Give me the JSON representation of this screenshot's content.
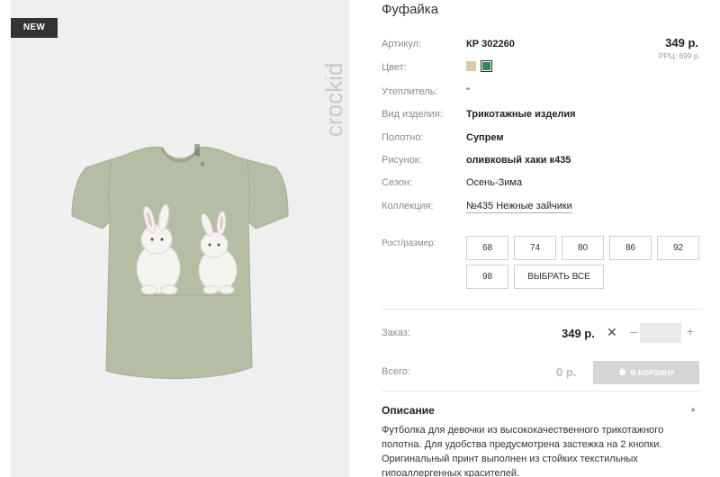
{
  "badge": "NEW",
  "brand": "crockid",
  "product": {
    "title": "Фуфайка",
    "price": "349 р.",
    "rrc": "РРЦ: 699 р."
  },
  "specs": {
    "article_label": "Артикул:",
    "article_value": "КР 302260",
    "color_label": "Цвет:",
    "insulation_label": "Утеплитель:",
    "insulation_value": "\"",
    "type_label": "Вид изделия:",
    "type_value": "Трикотажные изделия",
    "fabric_label": "Полотно:",
    "fabric_value": "Супрем",
    "pattern_label": "Рисунок:",
    "pattern_value": "оливковый хаки к435",
    "season_label": "Сезон:",
    "season_value": "Осень-Зима",
    "collection_label": "Коллекция:",
    "collection_value": "№435 Нежные зайчики"
  },
  "colors": {
    "swatch_beige": "#d9c9ac",
    "swatch_green": "#2e8b57",
    "shirt": "#b5bea5"
  },
  "sizes": {
    "label": "Рост/размер:",
    "options": [
      "68",
      "74",
      "80",
      "86",
      "92",
      "98"
    ],
    "select_all": "ВЫБРАТЬ ВСЕ"
  },
  "order": {
    "label": "Заказ:",
    "price": "349 р.",
    "times": "✕",
    "minus": "–",
    "plus": "+",
    "quantity": ""
  },
  "total": {
    "label": "Всего:",
    "value": "0 р.",
    "cart_button": "В КОРЗИНУ"
  },
  "description": {
    "title": "Описание",
    "text": "Футболка для девочки из высококачественного трикотажного полотна. Для удобства предусмотрена застежка на 2 кнопки. Оригинальный принт выполнен из стойких текстильных гипоаллергенных красителей."
  }
}
